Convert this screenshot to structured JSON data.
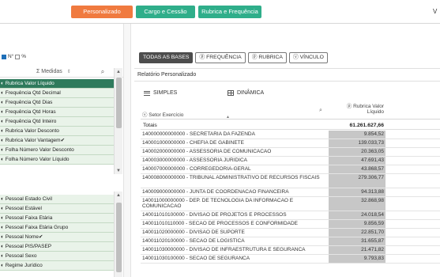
{
  "tabs": [
    "Personalizado",
    "Cargo e Cessão",
    "Rubrica e Frequência"
  ],
  "corner_letter": "V",
  "toggles": {
    "n_label": "N°",
    "pct_label": "%"
  },
  "measures": {
    "header": "Σ Medidas",
    "items": [
      "Rubrica Valor Líquido",
      "Frequência Qtd Decimal",
      "Frequência Qtd Dias",
      "Frequência Qtd Horas",
      "Frequência Qtd Inteiro",
      "Rubrica Valor Desconto",
      "Rubrica Valor Vantagem✔",
      "Folha Número Valor Desconto",
      "Folha Número Valor Líquido"
    ]
  },
  "dimensions": {
    "items": [
      "Pessoal Estado Civil",
      "Pessoal Estável",
      "Pessoal Faixa Etária",
      "Pessoal Faixa Etária Grupo",
      "Pessoal Nome✔",
      "Pessoal PIS/PASEP",
      "Pessoal Sexo",
      "Regime Jurídico"
    ]
  },
  "mode_buttons": [
    "TODAS AS BASES",
    "ⓟ FREQUÊNCIA",
    "ⓟ RUBRICA",
    "ⓥ VÍNCULO"
  ],
  "report": {
    "title": "Relatório Personalizado",
    "subtabs": [
      "SIMPLES",
      "DINÂMICA"
    ],
    "col_setor": "ⓥ Setor Exercício",
    "col_rubrica": "ⓟ Rubrica Valor Líquido",
    "totals_label": "Totais",
    "totals_value": "61.261.627,66",
    "totals_value2": "",
    "rows": [
      {
        "name": "140000000000000 - SECRETARIA DA FAZENDA",
        "value": "9.854,52"
      },
      {
        "name": "140001000000000 - CHEFIA DE GABINETE",
        "value": "139.033,73"
      },
      {
        "name": "140002000000000 - ASSESSORIA DE COMUNICACAO",
        "value": "20.363,05"
      },
      {
        "name": "140003000000000 - ASSESSORIA JURIDICA",
        "value": "47.691,43"
      },
      {
        "name": "140007000000000 - CORREGEDORIA-GERAL",
        "value": "43.868,57"
      },
      {
        "name": "140008000000000 - TRIBUNAL ADMINISTRATIVO DE RECURSOS FISCAIS",
        "value": "279.306,77"
      },
      {
        "name": "140009000000000 - JUNTA DE COORDENACAO FINANCEIRA",
        "value": "94.313,88"
      },
      {
        "name": "140011000000000 - DEP. DE TECNOLOGIA DA INFORMACAO E COMUNICACAO",
        "value": "32.868,98"
      },
      {
        "name": "140011010100000 - DIVISAO DE PROJETOS E PROCESSOS",
        "value": "24.018,54"
      },
      {
        "name": "140011010110000 - SECAO DE PROCESSOS E CONFORMIDADE",
        "value": "9.856,59"
      },
      {
        "name": "140011020000000 - DIVISAO DE SUPORTE",
        "value": "22.851,70"
      },
      {
        "name": "140011020100000 - SECAO DE LOGISTICA",
        "value": "31.655,87"
      },
      {
        "name": "140011030000000 - DIVISAO DE INFRAESTRUTURA E SEGURANCA",
        "value": "21.471,82"
      },
      {
        "name": "140011030100000 - SECAO DE SEGURANCA",
        "value": "9.793,83"
      }
    ]
  }
}
